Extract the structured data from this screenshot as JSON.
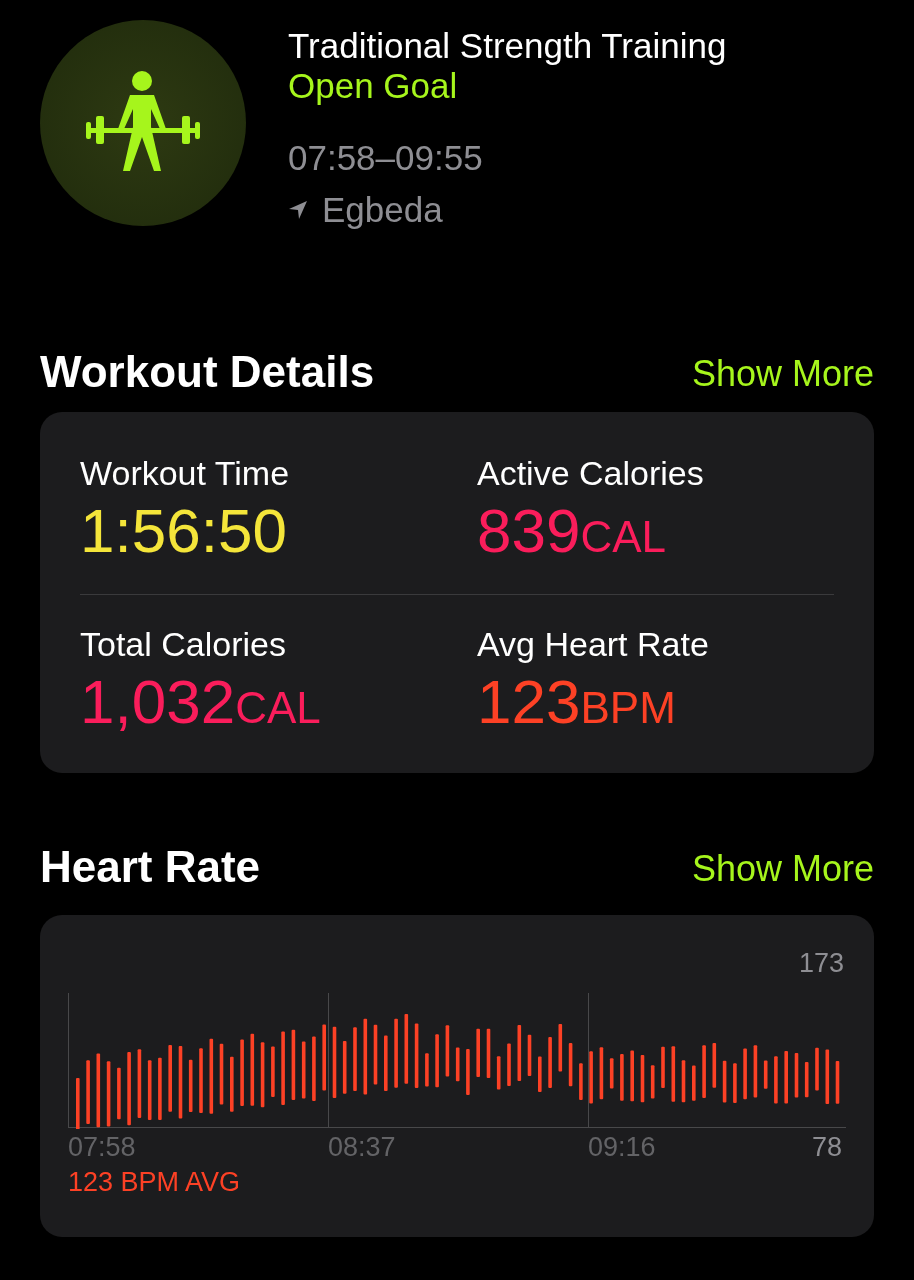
{
  "workout": {
    "title": "Traditional Strength Training",
    "goal": "Open Goal",
    "time_range": "07:58–09:55",
    "location": "Egbeda"
  },
  "details": {
    "title": "Workout Details",
    "show_more": "Show More",
    "metrics": [
      {
        "label": "Workout Time",
        "value": "1:56:50",
        "color": "#f4e53a"
      },
      {
        "label": "Active Calories",
        "value": "839",
        "unit": "CAL",
        "color": "#fa1d5b"
      },
      {
        "label": "Total Calories",
        "value": "1,032",
        "unit": "CAL",
        "color": "#fa1d5b"
      },
      {
        "label": "Avg Heart Rate",
        "value": "123",
        "unit": "BPM",
        "color": "#fd4125"
      }
    ]
  },
  "heart_rate": {
    "title": "Heart Rate",
    "show_more": "Show More",
    "max": "173",
    "min": "78",
    "times": [
      "07:58",
      "08:37",
      "09:16"
    ],
    "average": "123 BPM AVG"
  }
}
